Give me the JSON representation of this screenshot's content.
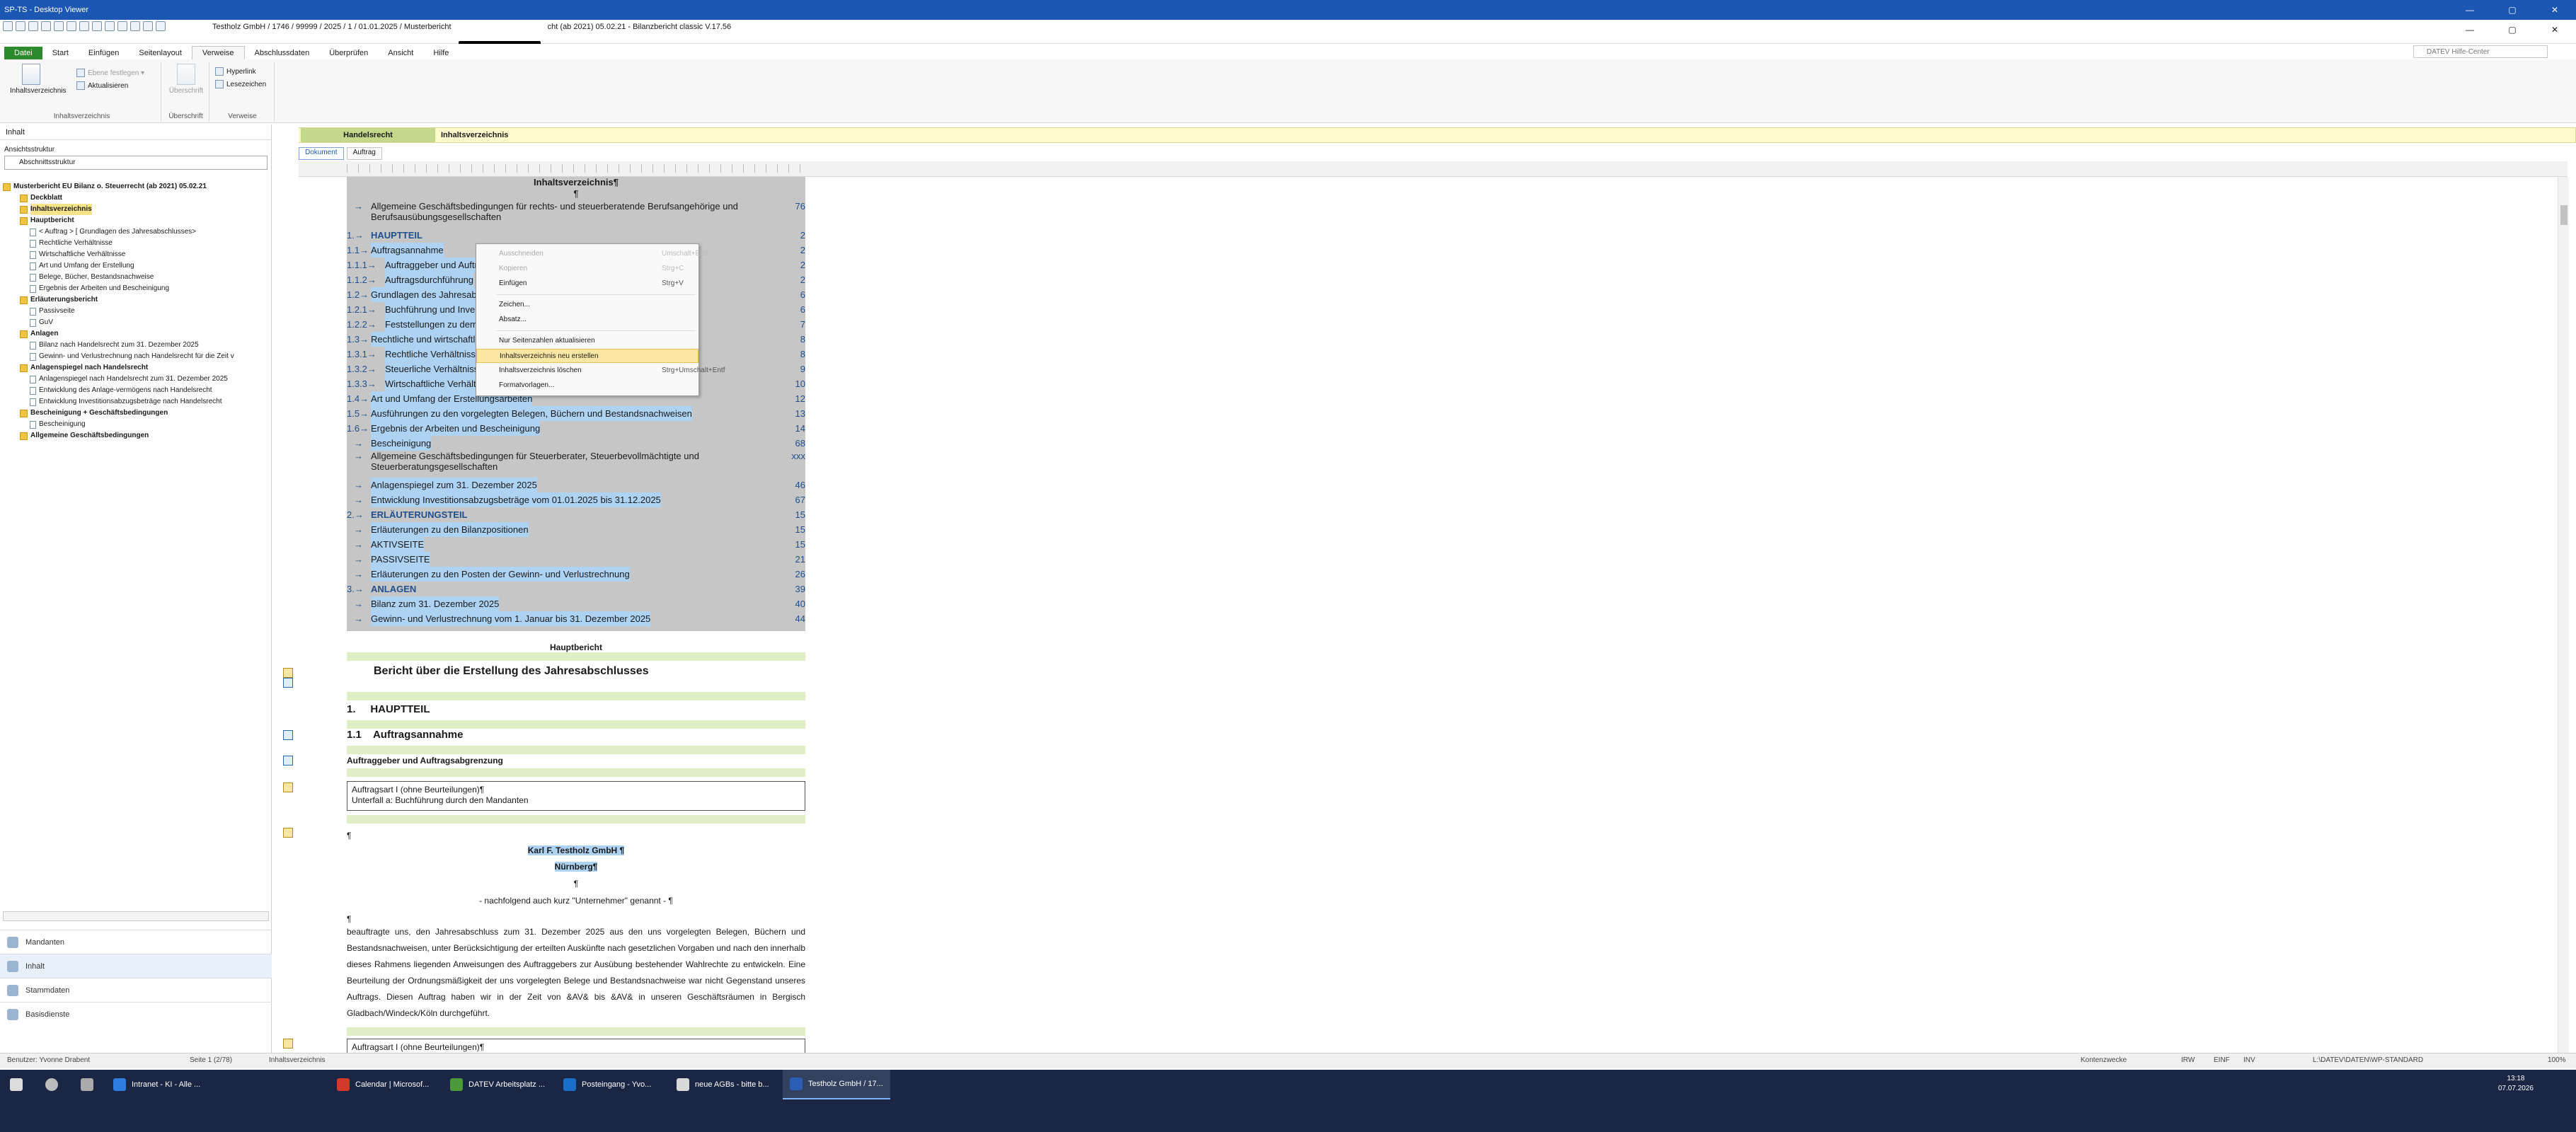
{
  "window": {
    "title": "SP-TS - Desktop Viewer",
    "controls": [
      "—",
      "▢",
      "✕"
    ]
  },
  "app": {
    "doc_title_left": "Testholz GmbH / 1746 / 99999 / 2025 / 1 / 01.01.2025 / Musterbericht",
    "doc_title_right": "cht (ab 2021) 05.02.21 - Bilanzbericht classic V.17.56",
    "help_search_placeholder": "DATEV Hilfe-Center",
    "app_controls": [
      "—",
      "▢",
      "✕"
    ]
  },
  "ribbon_tabs": [
    "Datei",
    "Start",
    "Einfügen",
    "Seitenlayout",
    "Verweise",
    "Abschlussdaten",
    "Überprüfen",
    "Ansicht",
    "Hilfe"
  ],
  "ribbon": {
    "groups": [
      {
        "label": "Inhaltsverzeichnis",
        "big": "Inhaltsverzeichnis",
        "small": [
          "Ebene festlegen ▾",
          "Aktualisieren"
        ]
      },
      {
        "label": "Überschrift",
        "big": "Überschrift"
      },
      {
        "label": "Verweise",
        "small": [
          "Hyperlink",
          "Lesezeichen"
        ]
      }
    ]
  },
  "left_panel": {
    "header": "Inhalt",
    "structure_label": "Ansichtsstruktur",
    "structure_value": "Abschnittsstruktur",
    "tree": [
      {
        "label": "Musterbericht EU Bilanz o. Steuerrecht (ab 2021) 05.02.21",
        "level": 0,
        "bold": true,
        "kind": "folder"
      },
      {
        "label": "Deckblatt",
        "level": 1,
        "bold": true,
        "kind": "folder"
      },
      {
        "label": "Inhaltsverzeichnis",
        "level": 1,
        "bold": true,
        "kind": "folder",
        "selected": true
      },
      {
        "label": "Hauptbericht",
        "level": 1,
        "bold": true,
        "kind": "folder"
      },
      {
        "label": "< Auftrag > [ Grundlagen des Jahresabschlusses>",
        "level": 2,
        "kind": "doc"
      },
      {
        "label": "Rechtliche Verhältnisse",
        "level": 2,
        "kind": "doc"
      },
      {
        "label": "Wirtschaftliche Verhältnisse",
        "level": 2,
        "kind": "doc"
      },
      {
        "label": "Art und Umfang der Erstellung",
        "level": 2,
        "kind": "doc"
      },
      {
        "label": "Belege, Bücher, Bestandsnachweise",
        "level": 2,
        "kind": "doc"
      },
      {
        "label": "Ergebnis der Arbeiten und Bescheinigung",
        "level": 2,
        "kind": "doc"
      },
      {
        "label": "Erläuterungsbericht",
        "level": 1,
        "bold": true,
        "kind": "folder"
      },
      {
        "label": "Passivseite",
        "level": 2,
        "kind": "doc"
      },
      {
        "label": "GuV",
        "level": 2,
        "kind": "doc"
      },
      {
        "label": "Anlagen",
        "level": 1,
        "bold": true,
        "kind": "folder"
      },
      {
        "label": "Bilanz nach Handelsrecht zum 31. Dezember 2025",
        "level": 2,
        "kind": "doc"
      },
      {
        "label": "Gewinn- und Verlustrechnung nach Handelsrecht für die Zeit v",
        "level": 2,
        "kind": "doc"
      },
      {
        "label": "Anlagenspiegel nach Handelsrecht",
        "level": 1,
        "bold": true,
        "kind": "folder"
      },
      {
        "label": "Anlagenspiegel nach Handelsrecht zum 31. Dezember 2025",
        "level": 2,
        "kind": "doc"
      },
      {
        "label": "Entwicklung des Anlage-vermögens nach Handelsrecht",
        "level": 2,
        "kind": "doc"
      },
      {
        "label": "Entwicklung Investitionsabzugsbeträge nach Handelsrecht",
        "level": 2,
        "kind": "doc"
      },
      {
        "label": "Bescheinigung + Geschäftsbedingungen",
        "level": 1,
        "bold": true,
        "kind": "folder"
      },
      {
        "label": "Bescheinigung",
        "level": 2,
        "kind": "doc"
      },
      {
        "label": "Allgemeine Geschäftsbedingungen",
        "level": 1,
        "bold": true,
        "kind": "folder"
      }
    ],
    "nav": [
      "Mandanten",
      "Inhalt",
      "Stammdaten",
      "Basisdienste"
    ]
  },
  "breadcrumb": {
    "left": "Handelsrecht",
    "right": "Inhaltsverzeichnis"
  },
  "doc_tabs": [
    "Dokument",
    "Auftrag"
  ],
  "toc": {
    "title": "Inhaltsverzeichnis¶",
    "pilcrow": "¶",
    "lines": [
      {
        "num": "→",
        "text": "Allgemeine Geschäftsbedingungen für rechts- und steuerberatende Berufsangehörige und Berufsausübungsgesellschaften",
        "page": "76"
      },
      {
        "num": "1.→",
        "text": "HAUPTTEIL",
        "page": "2",
        "bold": true
      },
      {
        "num": "1.1→",
        "text": "Auftragsannahme",
        "page": "2"
      },
      {
        "num": "1.1.1→",
        "text": "Auftraggeber und Auftragsabgrenzung",
        "page": "2"
      },
      {
        "num": "1.1.2→",
        "text": "Auftragsdurchführung",
        "page": "2"
      },
      {
        "num": "1.2→",
        "text": "Grundlagen des Jahresabschlusses",
        "page": "6"
      },
      {
        "num": "1.2.1→",
        "text": "Buchführung und Inventar",
        "page": "6"
      },
      {
        "num": "1.2.2→",
        "text": "Feststellungen zu dem Jahresabschluss",
        "page": "7"
      },
      {
        "num": "1.3→",
        "text": "Rechtliche und wirtschaftliche Verhältnisse",
        "page": "8"
      },
      {
        "num": "1.3.1→",
        "text": "Rechtliche Verhältnisse",
        "page": "8"
      },
      {
        "num": "1.3.2→",
        "text": "Steuerliche Verhältnisse",
        "page": "9"
      },
      {
        "num": "1.3.3→",
        "text": "Wirtschaftliche Verhältnisse",
        "page": "10"
      },
      {
        "num": "1.4→",
        "text": "Art und Umfang der Erstellungsarbeiten",
        "page": "12"
      },
      {
        "num": "1.5→",
        "text": "Ausführungen zu den vorgelegten Belegen, Büchern und Bestandsnachweisen",
        "page": "13"
      },
      {
        "num": "1.6→",
        "text": "Ergebnis der Arbeiten und Bescheinigung",
        "page": "14"
      },
      {
        "num": "→",
        "text": "Bescheinigung",
        "page": "68"
      },
      {
        "num": "→",
        "text": "Allgemeine Geschäftsbedingungen für Steuerberater, Steuerbevollmächtigte und Steuerberatungsgesellschaften",
        "page": "xxx"
      },
      {
        "num": "→",
        "text": "Anlagenspiegel zum 31. Dezember 2025",
        "page": "46"
      },
      {
        "num": "→",
        "text": "Entwicklung Investitionsabzugsbeträge vom 01.01.2025 bis 31.12.2025",
        "page": "67"
      },
      {
        "num": "2.→",
        "text": "ERLÄUTERUNGSTEIL",
        "page": "15",
        "bold": true
      },
      {
        "num": "→",
        "text": "Erläuterungen zu den Bilanzpositionen",
        "page": "15"
      },
      {
        "num": "→",
        "text": "AKTIVSEITE",
        "page": "15"
      },
      {
        "num": "→",
        "text": "PASSIVSEITE",
        "page": "21"
      },
      {
        "num": "→",
        "text": "Erläuterungen zu den Posten der Gewinn- und Verlustrechnung",
        "page": "26"
      },
      {
        "num": "3.→",
        "text": "ANLAGEN",
        "page": "39",
        "bold": true
      },
      {
        "num": "→",
        "text": "Bilanz zum 31. Dezember 2025",
        "page": "40"
      },
      {
        "num": "→",
        "text": "Gewinn- und Verlustrechnung vom 1. Januar bis 31. Dezember 2025",
        "page": "44"
      }
    ]
  },
  "body": {
    "section_label": "Hauptbericht",
    "report_title": "Bericht über die Erstellung des Jahresabschlusses",
    "h1": "1.     HAUPTTEIL",
    "h2": "1.1    Auftragsannahme",
    "h3": "Auftraggeber und Auftragsabgrenzung",
    "box1_line1": "Auftragsart I (ohne Beurteilungen)¶",
    "box1_line2": "Unterfall a: Buchführung durch den Mandanten",
    "pilcrow": "¶",
    "company": "Karl F. Testholz GmbH ¶",
    "city": "Nürnberg¶",
    "alias": "- nachfolgend auch kurz \"Unternehmer\" genannt - ¶",
    "paragraph": "beauftragte uns, den Jahresabschluss zum 31. Dezember 2025 aus den uns vorgelegten Belegen, Büchern und Bestandsnachweisen, unter Berücksichtigung der erteilten Auskünfte nach gesetzlichen Vorgaben und nach den innerhalb dieses Rahmens liegenden Anweisungen des Auftraggebers zur Ausübung bestehender Wahlrechte zu entwickeln. Eine Beurteilung der Ordnungsmäßigkeit der uns vorgelegten Belege und Bestandsnachweise war nicht Gegenstand unseres Auftrags. Diesen Auftrag haben wir in der Zeit von &AV& bis &AV& in unseren Geschäftsräumen in Bergisch Gladbach/Windeck/Köln durchgeführt.",
    "box2": "Auftragsart I (ohne Beurteilungen)¶"
  },
  "context_menu": [
    {
      "label": "Ausschneiden",
      "shortcut": "Umschalt+Entf",
      "disabled": true
    },
    {
      "label": "Kopieren",
      "shortcut": "Strg+C",
      "disabled": true
    },
    {
      "label": "Einfügen",
      "shortcut": "Strg+V"
    },
    {
      "sep": true
    },
    {
      "label": "Zeichen..."
    },
    {
      "label": "Absatz..."
    },
    {
      "sep": true
    },
    {
      "label": "Nur Seitenzahlen aktualisieren"
    },
    {
      "label": "Inhaltsverzeichnis neu erstellen",
      "highlight": true
    },
    {
      "label": "Inhaltsverzeichnis löschen",
      "shortcut": "Strg+Umschalt+Entf"
    },
    {
      "label": "Formatvorlagen..."
    }
  ],
  "statusbar": {
    "user": "Benutzer: Yvonne Drabent",
    "page": "Seite 1 (2/78)",
    "section": "Inhaltsverzeichnis",
    "right1": "Kontenzwecke",
    "modes": [
      "IRW",
      "EINF",
      "INV"
    ],
    "path": "L:\\DATEV\\DATEN\\WP-STANDARD",
    "zoom": "100%"
  },
  "taskbar": {
    "items": [
      {
        "label": "Intranet - KI - Alle ...",
        "color": "#2f7de1"
      },
      {
        "label": "Calendar | Microsof...",
        "color": "#d43a2a"
      },
      {
        "label": "DATEV Arbeitsplatz ...",
        "color": "#4a9a3a"
      },
      {
        "label": "Posteingang - Yvo...",
        "color": "#1a6fc8"
      },
      {
        "label": "neue AGBs - bitte b...",
        "color": "#d8d8d8"
      },
      {
        "label": "Testholz GmbH / 17...",
        "color": "#2b5fb5",
        "active": true
      }
    ],
    "time": "13:18",
    "date": "07.07.2026"
  }
}
